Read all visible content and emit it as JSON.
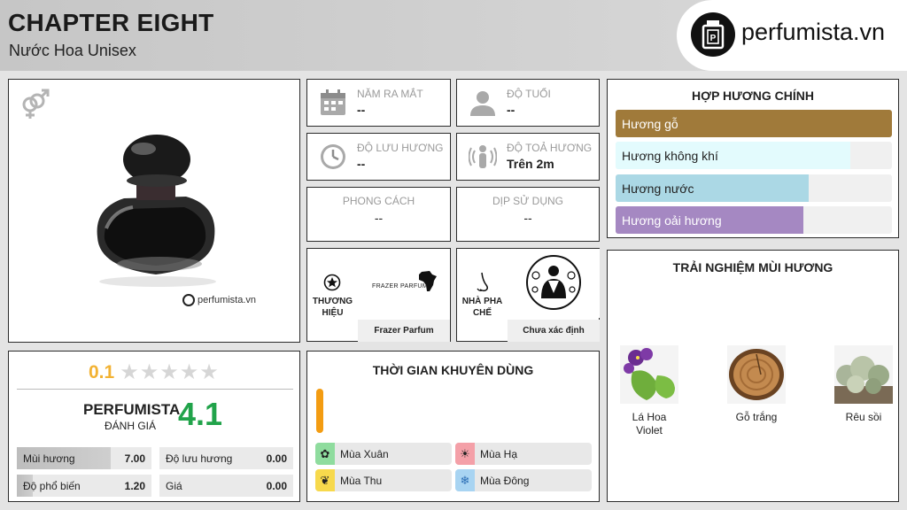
{
  "header": {
    "title": "CHAPTER EIGHT",
    "subtitle": "Nước Hoa Unisex",
    "logo_text": "perfumista.vn"
  },
  "product": {
    "watermark": "perfumista.vn",
    "gender_icon": "unisex-gender-icon"
  },
  "rating": {
    "average": "0.1",
    "stars_total": 5,
    "stars_filled": 0,
    "brand_label": "PERFUMISTA",
    "brand_sublabel": "ĐÁNH GIÁ",
    "brand_score": "4.1",
    "metrics": [
      {
        "label": "Mùi hương",
        "value": "7.00",
        "fraction": 0.7
      },
      {
        "label": "Độ lưu hương",
        "value": "0.00",
        "fraction": 0
      },
      {
        "label": "Độ phổ biến",
        "value": "1.20",
        "fraction": 0.12
      },
      {
        "label": "Giá",
        "value": "0.00",
        "fraction": 0
      }
    ]
  },
  "info": {
    "release_label": "NĂM RA MẮT",
    "release_value": "--",
    "age_label": "ĐỘ TUỔI",
    "age_value": "--",
    "longevity_label": "ĐỘ LƯU HƯƠNG",
    "longevity_value": "--",
    "sillage_label": "ĐỘ TOẢ HƯƠNG",
    "sillage_value": "Trên 2m",
    "style_label": "PHONG CÁCH",
    "style_value": "--",
    "occasion_label": "DỊP SỬ DỤNG",
    "occasion_value": "--"
  },
  "brand": {
    "side_label": "THƯƠNG HIỆU",
    "logo_text": "FRAZER PARFUM",
    "name": "Frazer Parfum"
  },
  "perfumer": {
    "side_label": "NHÀ PHA CHẾ",
    "name": "Chưa xác định"
  },
  "seasons": {
    "heading": "THỜI GIAN KHUYÊN DÙNG",
    "items": [
      {
        "label": "Mùa Xuân",
        "icon": "flower-icon",
        "color": "#8fdc9e"
      },
      {
        "label": "Mùa Hạ",
        "icon": "sun-icon",
        "color": "#f4a0a8"
      },
      {
        "label": "Mùa Thu",
        "icon": "leaf-icon",
        "color": "#f7d94c"
      },
      {
        "label": "Mùa Đông",
        "icon": "snowflake-icon",
        "color": "#a8d4f2"
      }
    ]
  },
  "accords": {
    "heading": "HỢP HƯƠNG CHÍNH",
    "items": [
      {
        "label": "Hương gỗ",
        "color": "#a07a3a",
        "fraction": 1.0
      },
      {
        "label": "Hương không khí",
        "color": "#e3fbfd",
        "fraction": 0.85
      },
      {
        "label": "Hương nước",
        "color": "#abd8e5",
        "fraction": 0.7
      },
      {
        "label": "Hương oải hương",
        "color": "#a588c2",
        "fraction": 0.68
      }
    ]
  },
  "notes": {
    "heading": "TRẢI NGHIỆM MÙI HƯƠNG",
    "items": [
      {
        "label": "Lá Hoa Violet"
      },
      {
        "label": "Gỗ trắng"
      },
      {
        "label": "Rêu sồi"
      }
    ]
  }
}
